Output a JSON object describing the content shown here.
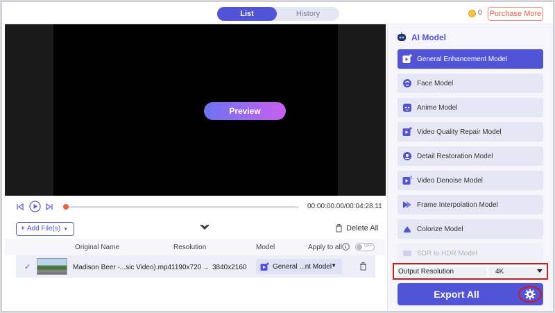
{
  "header": {
    "tabs": [
      {
        "label": "List",
        "active": true
      },
      {
        "label": "History",
        "active": false
      }
    ],
    "coin_icon": "coin-icon",
    "coin_count": "0",
    "purchase_label": "Purchase More",
    "accent_color": "#5254d8"
  },
  "player": {
    "preview_label": "Preview",
    "time": "00:00:00.00/00:04:28.11",
    "progress": 0.0,
    "icons": [
      "previous-icon",
      "play-icon",
      "next-icon"
    ]
  },
  "filebar": {
    "add_files_label": "Add File(s)",
    "delete_all_label": "Delete All"
  },
  "table": {
    "columns": [
      "Original Name",
      "Resolution",
      "Model",
      "Apply to all"
    ],
    "apply_toggle_label": "OFF",
    "rows": [
      {
        "name": "Madison Beer -...sic Video).mp4",
        "res_from": "1190x720",
        "arrow": "→",
        "res_to": "3840x2160",
        "model": "General ...nt Model",
        "checked": true
      }
    ]
  },
  "panel": {
    "title": "AI Model",
    "models": [
      {
        "label": "General Enhancement Model",
        "active": true,
        "icon": "video-star-icon"
      },
      {
        "label": "Face Model",
        "active": false,
        "icon": "face-icon"
      },
      {
        "label": "Anime Model",
        "active": false,
        "icon": "anime-icon"
      },
      {
        "label": "Video Quality Repair Model",
        "active": false,
        "icon": "video-star-icon"
      },
      {
        "label": "Detail Restoration Model",
        "active": false,
        "icon": "detail-icon"
      },
      {
        "label": "Video Denoise Model",
        "active": false,
        "icon": "denoise-icon"
      },
      {
        "label": "Frame Interpolation Model",
        "active": false,
        "icon": "frame-icon"
      },
      {
        "label": "Colorize Model",
        "active": false,
        "icon": "colorize-icon"
      },
      {
        "label": "SDR to HDR Model",
        "active": false,
        "icon": "hdr-icon"
      }
    ],
    "output_resolution_label": "Output Resolution",
    "output_resolution_value": "4K",
    "export_label": "Export All",
    "highlight_color": "#d41818"
  }
}
